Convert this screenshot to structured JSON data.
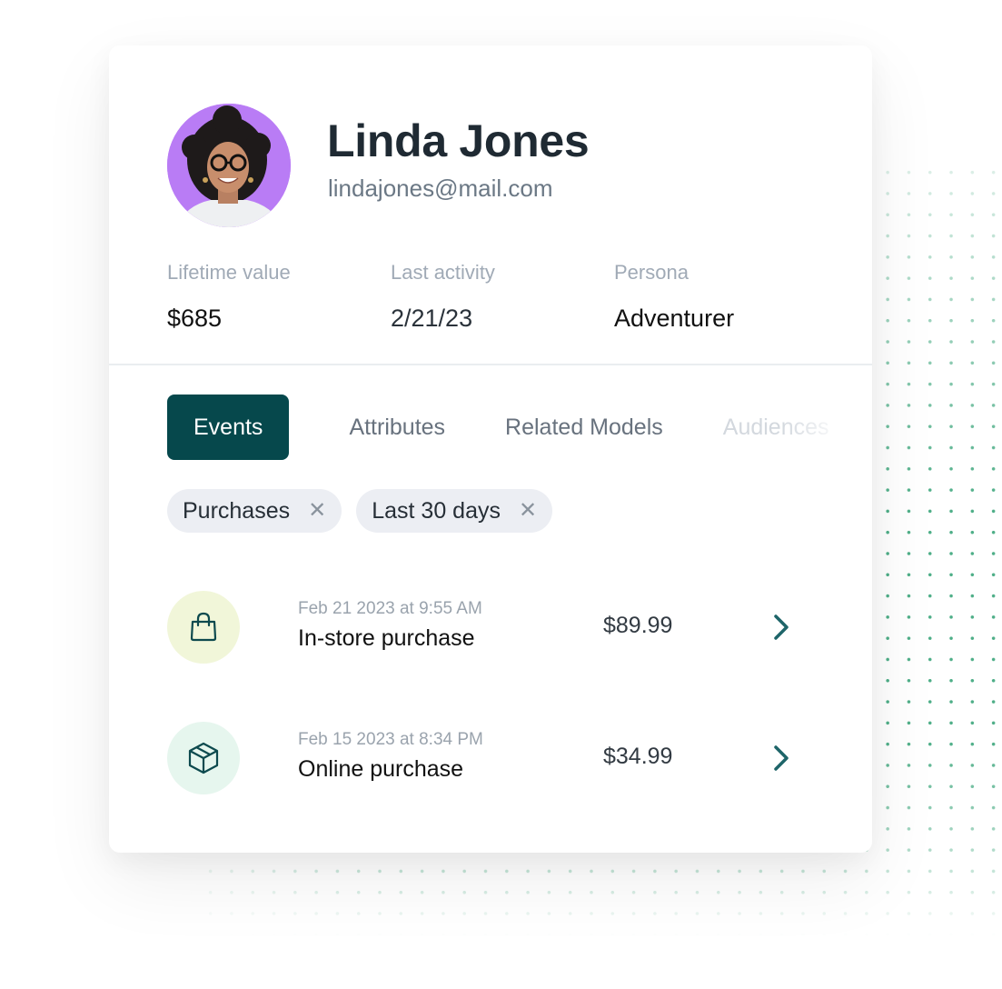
{
  "profile": {
    "name": "Linda Jones",
    "email": "lindajones@mail.com",
    "avatar_bg": "#b97cf5"
  },
  "stats": [
    {
      "label": "Lifetime value",
      "value": "$685"
    },
    {
      "label": "Last activity",
      "value": "2/21/23"
    },
    {
      "label": "Persona",
      "value": "Adventurer"
    }
  ],
  "tabs": [
    {
      "label": "Events",
      "active": true
    },
    {
      "label": "Attributes",
      "active": false
    },
    {
      "label": "Related Models",
      "active": false
    },
    {
      "label": "Audiences",
      "active": false
    }
  ],
  "filters": [
    {
      "label": "Purchases",
      "remove_icon": "close-icon"
    },
    {
      "label": "Last 30 days",
      "remove_icon": "close-icon"
    }
  ],
  "events": [
    {
      "timestamp": "Feb 21 2023 at 9:55 AM",
      "title": "In-store purchase",
      "amount": "$89.99",
      "icon": "shopping-bag-icon",
      "icon_bg": "#f1f6d9"
    },
    {
      "timestamp": "Feb 15 2023 at 8:34 PM",
      "title": "Online purchase",
      "amount": "$34.99",
      "icon": "package-box-icon",
      "icon_bg": "#e6f6ee"
    }
  ],
  "colors": {
    "accent": "#06484c",
    "chevron": "#1e6569",
    "dots": "#3aa57a"
  }
}
